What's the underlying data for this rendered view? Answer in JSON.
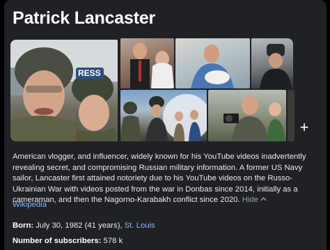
{
  "title": "Patrick Lancaster",
  "gallery": {
    "images": [
      {
        "name": "selfie-with-woman-helmets",
        "overlay": "RESS"
      },
      {
        "name": "wedding-photo"
      },
      {
        "name": "man-holding-baby"
      },
      {
        "name": "man-in-fur-hat"
      },
      {
        "name": "group-in-helmets"
      },
      {
        "name": "man-with-camera-and-child"
      }
    ],
    "more_icon": "plus-icon",
    "more_label": "+"
  },
  "description": {
    "text": "American vlogger, and influencer, widely known for his YouTube videos inadvertently revealing secret, and compromising Russian military information. A former US Navy sailor, Lancaster first attained notoriety due to his YouTube videos on the Russo-Ukrainian War with videos posted from the war in Donbas since 2014, initially as a cameraman, and then the Nagorno-Karabakh conflict since 2020.",
    "hide_label": "Hide",
    "hide_icon": "chevron-up-icon",
    "source_link": "Wikipedia"
  },
  "facts": {
    "born_label": "Born:",
    "born_value": "July 30, 1982 (41 years),",
    "born_place": "St. Louis",
    "subscribers_label": "Number of subscribers:",
    "subscribers_value": "578 k"
  },
  "colors": {
    "background": "#202124",
    "text": "#e8eaed",
    "link": "#8ab4f8"
  }
}
